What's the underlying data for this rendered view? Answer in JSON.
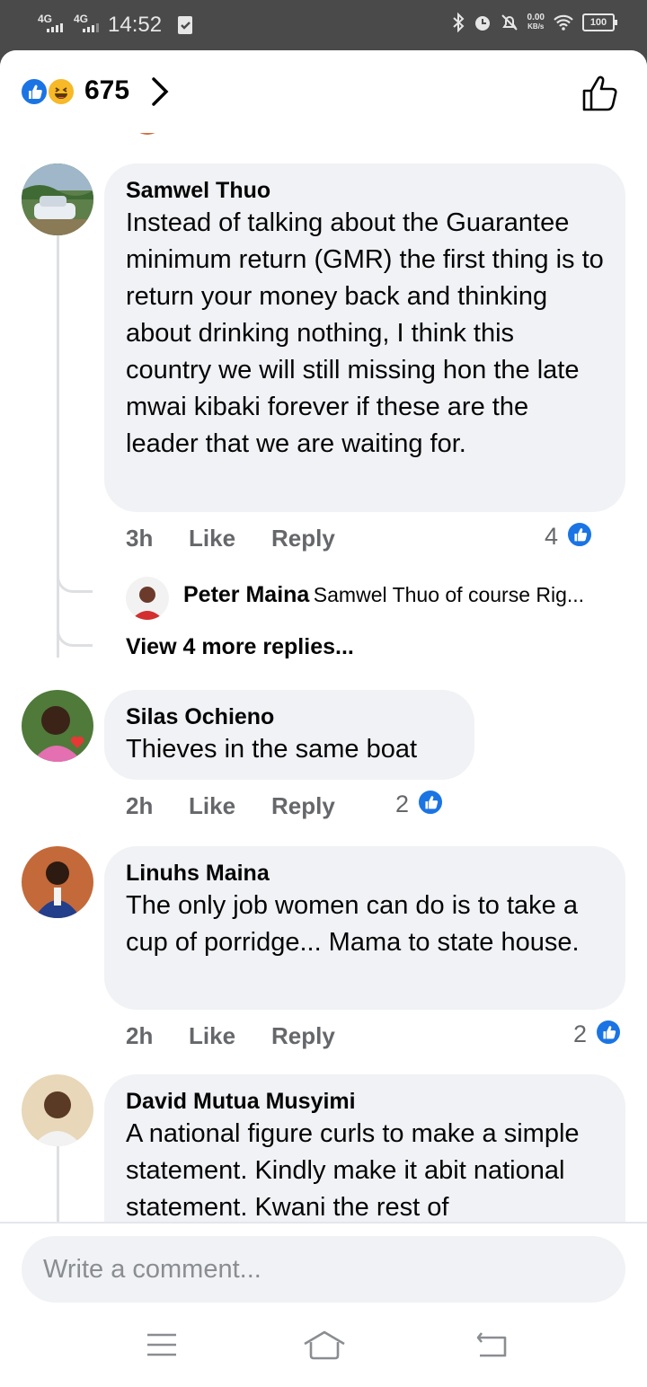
{
  "status_bar": {
    "network_1": "4G",
    "network_2": "4G",
    "time": "14:52",
    "speed_value": "0.00",
    "speed_unit": "KB/s",
    "battery": "100"
  },
  "header": {
    "reaction_count": "675",
    "reaction_icons": [
      "like-icon",
      "haha-icon"
    ]
  },
  "comments": [
    {
      "author": "Samwel Thuo",
      "text": "Instead of talking about the Guarantee minimum return (GMR) the first thing is to return your money back and thinking about drinking nothing, I think this country we will still missing hon the late mwai kibaki forever if these are the leader that we are waiting for.",
      "time": "3h",
      "like_label": "Like",
      "reply_label": "Reply",
      "reaction_count": "4",
      "reply": {
        "author": "Peter Maina",
        "text": "Samwel Thuo of course Rig..."
      },
      "more_replies": "View 4 more replies..."
    },
    {
      "author": "Silas Ochieno",
      "text": "Thieves in the same boat",
      "time": "2h",
      "like_label": "Like",
      "reply_label": "Reply",
      "reaction_count": "2"
    },
    {
      "author": "Linuhs Maina",
      "text": "The only job women can do is to take a cup of porridge... Mama  to state house.",
      "time": "2h",
      "like_label": "Like",
      "reply_label": "Reply",
      "reaction_count": "2"
    },
    {
      "author": "David Mutua Musyimi",
      "text": "A national figure curls to make a simple statement. Kindly make it abit national statement. Kwani the rest of"
    }
  ],
  "composer": {
    "placeholder": "Write a comment..."
  },
  "colors": {
    "accent": "#1b74e4",
    "haha": "#f7b928",
    "bubble": "#f0f2f5",
    "meta_text": "#65676b"
  }
}
